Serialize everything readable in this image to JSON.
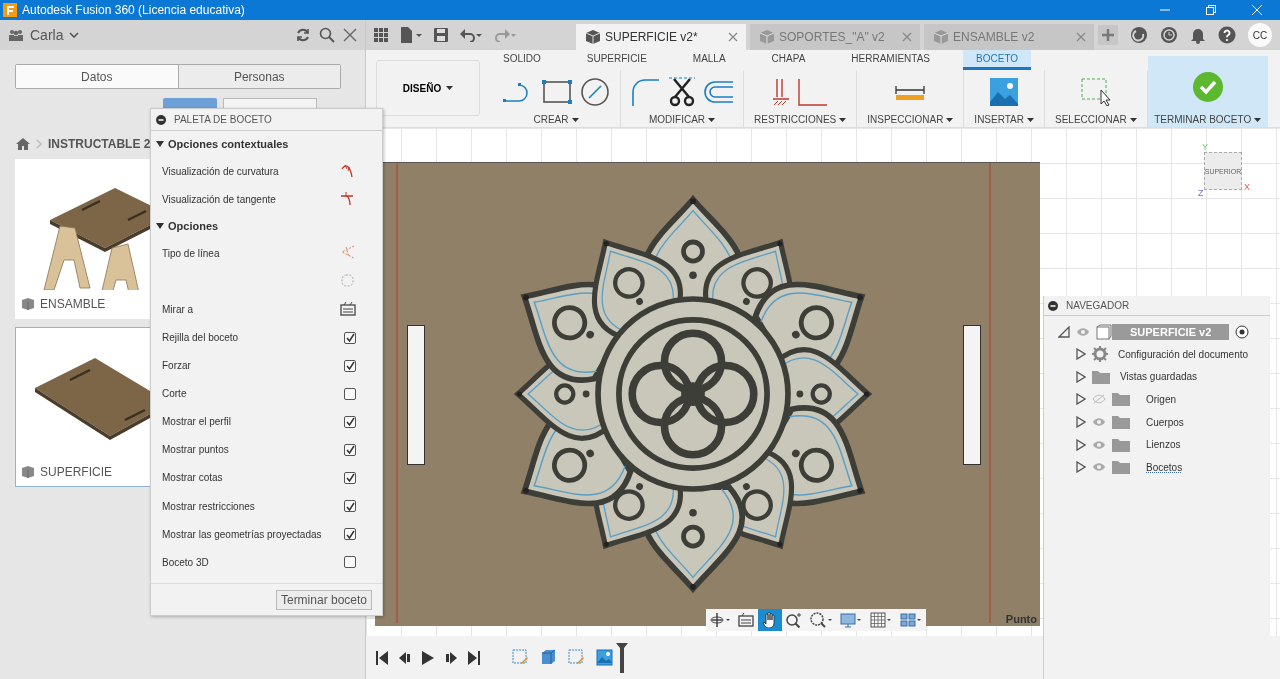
{
  "window": {
    "title": "Autodesk Fusion 360 (Licencia educativa)"
  },
  "data_panel": {
    "user": "Carla",
    "tabs": [
      {
        "label": "Datos",
        "selected": true
      },
      {
        "label": "Personas",
        "selected": false
      }
    ],
    "breadcrumb": "INSTRUCTABLE 2",
    "designs": [
      {
        "name": "ENSAMBLE",
        "kind": "stool",
        "selected": false
      },
      {
        "name": "SUPERFICIE",
        "kind": "board",
        "selected": true
      }
    ]
  },
  "document_tabs": [
    {
      "label": "SUPERFICIE v2*",
      "selected": true
    },
    {
      "label": "SOPORTES_\"A\" v2",
      "selected": false
    },
    {
      "label": "ENSAMBLE v2",
      "selected": false
    }
  ],
  "user_initials": "CC",
  "ribbon": {
    "workspace": "DISEÑO",
    "tabs": [
      {
        "label": "SOLIDO",
        "selected": false
      },
      {
        "label": "SUPERFICIE",
        "selected": false
      },
      {
        "label": "MALLA",
        "selected": false
      },
      {
        "label": "CHAPA",
        "selected": false
      },
      {
        "label": "HERRAMIENTAS",
        "selected": false
      },
      {
        "label": "BOCETO",
        "selected": true
      }
    ],
    "groups": [
      {
        "label": "CREAR",
        "kind": "create",
        "active": false
      },
      {
        "label": "MODIFICAR",
        "kind": "modify",
        "active": false
      },
      {
        "label": "RESTRICCIONES",
        "kind": "constraints",
        "active": false
      },
      {
        "label": "INSPECCIONAR",
        "kind": "inspect",
        "active": false
      },
      {
        "label": "INSERTAR",
        "kind": "insert",
        "active": false
      },
      {
        "label": "SELECCIONAR",
        "kind": "select",
        "active": false
      },
      {
        "label": "TERMINAR BOCETO",
        "kind": "finish",
        "active": true
      }
    ]
  },
  "sketch_palette": {
    "title": "PALETA DE BOCETO",
    "sections": [
      {
        "title": "Opciones contextuales",
        "expanded": true,
        "items": [
          {
            "label": "Visualización de curvatura",
            "kind": "curvature"
          },
          {
            "label": "Visualización de tangente",
            "kind": "tangent"
          }
        ]
      },
      {
        "title": "Opciones",
        "expanded": true,
        "items": [
          {
            "label": "Tipo de línea",
            "kind": "linetype"
          },
          {
            "kind": "construction"
          },
          {
            "label": "Mirar a",
            "kind": "lookat"
          },
          {
            "label": "Rejilla del boceto",
            "kind": "checkbox",
            "checked": true
          },
          {
            "label": "Forzar",
            "kind": "checkbox",
            "checked": true
          },
          {
            "label": "Corte",
            "kind": "checkbox",
            "checked": false
          },
          {
            "label": "Mostrar el perfil",
            "kind": "checkbox",
            "checked": true
          },
          {
            "label": "Mostrar puntos",
            "kind": "checkbox",
            "checked": true
          },
          {
            "label": "Mostrar cotas",
            "kind": "checkbox",
            "checked": true
          },
          {
            "label": "Mostrar restricciones",
            "kind": "checkbox",
            "checked": true
          },
          {
            "label": "Mostrar las geometrías proyectadas",
            "kind": "checkbox",
            "checked": true
          },
          {
            "label": "Boceto 3D",
            "kind": "checkbox",
            "checked": false
          }
        ]
      }
    ],
    "finish_button": "Terminar boceto"
  },
  "viewcube": {
    "face": "SUPERIOR",
    "axes": [
      "Y",
      "X",
      "Z"
    ]
  },
  "canvas": {
    "status": "Punto",
    "view_tools": [
      {
        "kind": "orbit",
        "selected": false
      },
      {
        "kind": "lookat",
        "selected": false
      },
      {
        "kind": "pan",
        "selected": true
      },
      {
        "kind": "zoom",
        "selected": false
      },
      {
        "kind": "fit",
        "selected": false
      },
      {
        "kind": "display",
        "selected": false
      },
      {
        "kind": "grid",
        "selected": false
      },
      {
        "kind": "viewports",
        "selected": false
      }
    ]
  },
  "navigator": {
    "title": "NAVEGADOR",
    "root": {
      "label": "SUPERFICIE v2",
      "visible": true,
      "expanded": true,
      "children": [
        {
          "label": "Configuración del documento",
          "kind": "settings"
        },
        {
          "label": "Vistas guardadas",
          "kind": "views"
        },
        {
          "label": "Origen",
          "kind": "folder",
          "visible": false
        },
        {
          "label": "Cuerpos",
          "kind": "folder",
          "visible": true
        },
        {
          "label": "Lienzos",
          "kind": "folder",
          "visible": true
        },
        {
          "label": "Bocetos",
          "kind": "sketches",
          "visible": true
        }
      ]
    }
  },
  "timeline": {
    "features": [
      {
        "kind": "sketch"
      },
      {
        "kind": "extrude"
      },
      {
        "kind": "sketch"
      },
      {
        "kind": "canvas"
      }
    ]
  }
}
